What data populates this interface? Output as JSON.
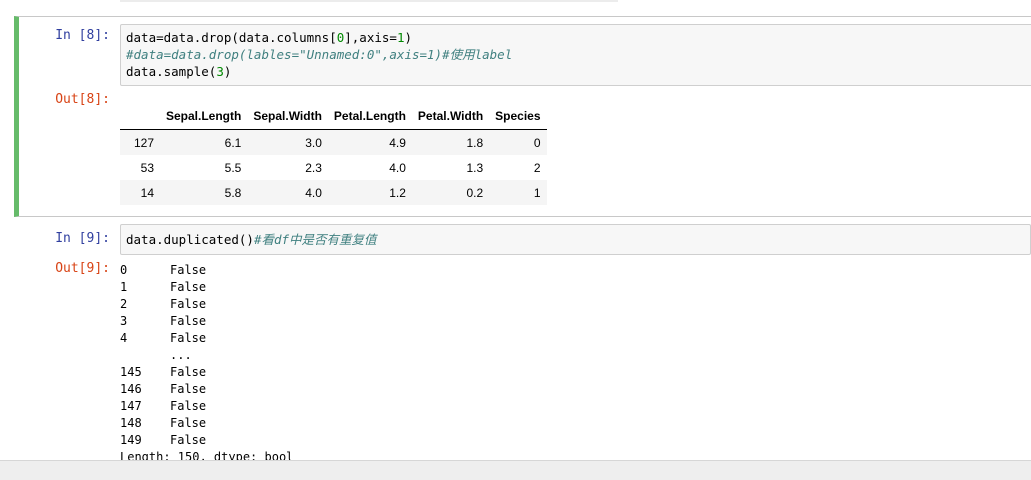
{
  "cell8": {
    "in_prompt": "In [8]:",
    "out_prompt": "Out[8]:",
    "code": [
      {
        "parts": [
          {
            "t": "data=data.drop(data.columns["
          },
          {
            "t": "0",
            "c": "num"
          },
          {
            "t": "],axis="
          },
          {
            "t": "1",
            "c": "num"
          },
          {
            "t": ")"
          }
        ]
      },
      {
        "parts": [
          {
            "t": "#data=data.drop(lables=\"Unnamed:0\",axis=1)#使用label",
            "c": "cm"
          }
        ]
      },
      {
        "parts": [
          {
            "t": "data.sample("
          },
          {
            "t": "3",
            "c": "num"
          },
          {
            "t": ")"
          }
        ]
      }
    ],
    "table": {
      "columns": [
        "",
        "Sepal.Length",
        "Sepal.Width",
        "Petal.Length",
        "Petal.Width",
        "Species"
      ],
      "rows": [
        {
          "index": "127",
          "values": [
            "6.1",
            "3.0",
            "4.9",
            "1.8",
            "0"
          ]
        },
        {
          "index": "53",
          "values": [
            "5.5",
            "2.3",
            "4.0",
            "1.3",
            "2"
          ]
        },
        {
          "index": "14",
          "values": [
            "5.8",
            "4.0",
            "1.2",
            "0.2",
            "1"
          ]
        }
      ]
    }
  },
  "cell9": {
    "in_prompt": "In [9]:",
    "out_prompt": "Out[9]:",
    "code": [
      {
        "parts": [
          {
            "t": "data.duplicated()"
          },
          {
            "t": "#看df中是否有重复值",
            "c": "cm"
          }
        ]
      }
    ],
    "series_rows": [
      {
        "index": "0",
        "value": "False"
      },
      {
        "index": "1",
        "value": "False"
      },
      {
        "index": "2",
        "value": "False"
      },
      {
        "index": "3",
        "value": "False"
      },
      {
        "index": "4",
        "value": "False"
      },
      {
        "index": "",
        "value": "..."
      },
      {
        "index": "145",
        "value": "False"
      },
      {
        "index": "146",
        "value": "False"
      },
      {
        "index": "147",
        "value": "False"
      },
      {
        "index": "148",
        "value": "False"
      },
      {
        "index": "149",
        "value": "False"
      }
    ],
    "footer": "Length: 150, dtype: bool"
  },
  "colors": {
    "selected_cell_border": "#66bb6a",
    "in_prompt": "#303f9f",
    "out_prompt": "#d84315",
    "number_literal": "#008800",
    "comment": "#408080"
  }
}
